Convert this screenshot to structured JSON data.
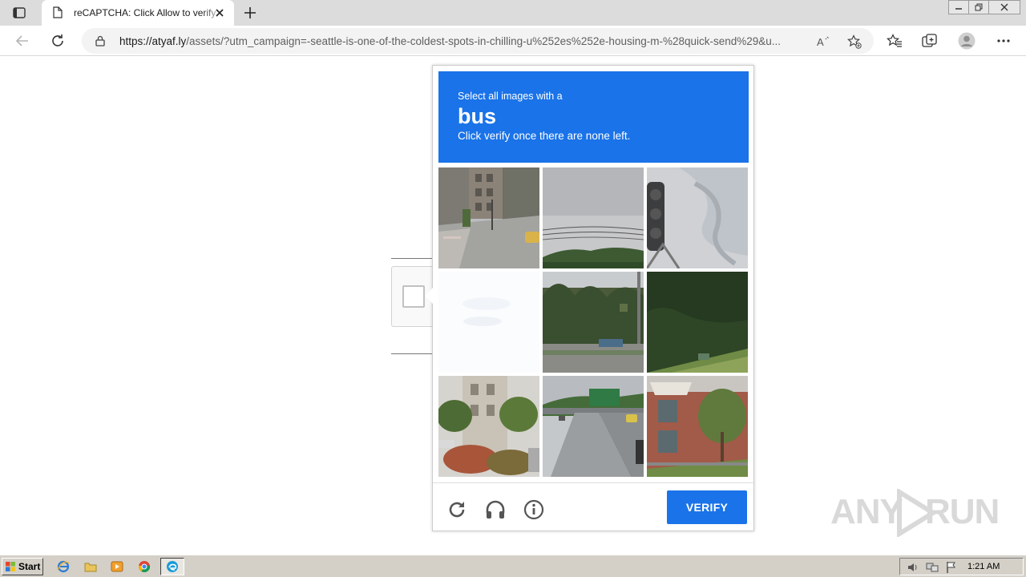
{
  "browser": {
    "tab_title": "reCAPTCHA: Click Allow to verify",
    "url_host": "https://atyaf.ly",
    "url_rest": "/assets/?utm_campaign=-seattle-is-one-of-the-coldest-spots-in-chilling-u%252es%252e-housing-m-%28quick-send%29&u...",
    "icons": {
      "tab_actions": "tab-actions-icon",
      "tab": "document-icon",
      "close": "close-icon",
      "new_tab": "plus-icon",
      "back": "back-arrow-icon",
      "refresh": "refresh-icon",
      "lock": "lock-icon",
      "read_aloud": "read-aloud-icon",
      "add_favorite": "add-favorite-icon",
      "favorites": "favorites-icon",
      "collections": "collections-icon",
      "profile": "profile-icon",
      "more": "more-icon"
    }
  },
  "captcha": {
    "prompt_line1": "Select all images with a",
    "target_word": "bus",
    "prompt_line3": "Click verify once there are none left.",
    "verify_label": "VERIFY",
    "accent_color": "#1a73e8",
    "tiles": [
      "street-corner-buildings-taxi",
      "sky-power-lines-trees",
      "traffic-light-cloudy-sky",
      "blank-fading-tile",
      "palm-trees-street-pole",
      "grassy-hillside-trees",
      "apartment-building-shrubs",
      "highway-road-sign-cars",
      "brick-house-awning-tree"
    ],
    "footer_icons": [
      "reload-icon",
      "headphones-icon",
      "info-icon"
    ]
  },
  "watermark": {
    "text_left": "ANY",
    "text_right": "RUN"
  },
  "taskbar": {
    "start_label": "Start",
    "clock": "1:21 AM",
    "apps": [
      "ie-icon",
      "folder-icon",
      "media-player-icon",
      "chrome-icon",
      "edge-icon"
    ],
    "tray": [
      "volume-icon",
      "network-icon",
      "flag-icon"
    ]
  }
}
